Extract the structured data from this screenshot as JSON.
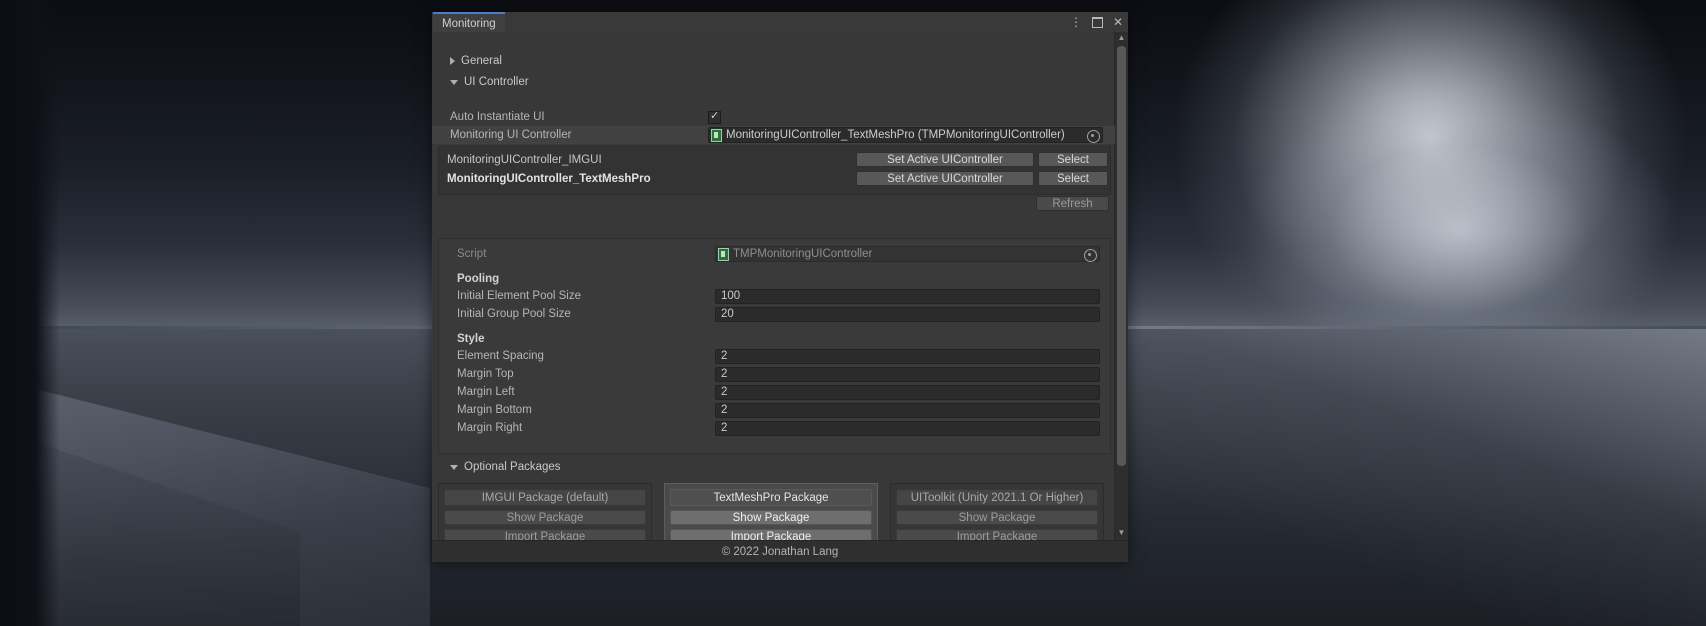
{
  "window": {
    "tab_label": "Monitoring",
    "menu_icon": "⋮",
    "maximize_icon": "maximize",
    "close_icon": "✕"
  },
  "foldouts": {
    "general": "General",
    "ui_controller": "UI Controller",
    "optional_packages": "Optional Packages"
  },
  "ui_controller": {
    "auto_instantiate_label": "Auto Instantiate UI",
    "auto_instantiate_checked": true,
    "controller_label": "Monitoring UI Controller",
    "controller_value": "MonitoringUIController_TextMeshPro (TMPMonitoringUIController)"
  },
  "controller_list": {
    "rows": [
      {
        "name": "MonitoringUIController_IMGUI",
        "active": false,
        "set_active_label": "Set Active UIController",
        "select_label": "Select"
      },
      {
        "name": "MonitoringUIController_TextMeshPro",
        "active": true,
        "set_active_label": "Set Active UIController",
        "select_label": "Select"
      }
    ],
    "refresh_label": "Refresh"
  },
  "inspector": {
    "script_label": "Script",
    "script_value": "TMPMonitoringUIController",
    "pooling_header": "Pooling",
    "style_header": "Style",
    "fields": [
      {
        "label": "Initial Element Pool Size",
        "value": "100"
      },
      {
        "label": "Initial Group Pool Size",
        "value": "20"
      },
      {
        "label": "Element Spacing",
        "value": "2"
      },
      {
        "label": "Margin Top",
        "value": "2"
      },
      {
        "label": "Margin Left",
        "value": "2"
      },
      {
        "label": "Margin Bottom",
        "value": "2"
      },
      {
        "label": "Margin Right",
        "value": "2"
      }
    ]
  },
  "packages": [
    {
      "title": "IMGUI Package (default)",
      "show_label": "Show Package",
      "import_label": "Import Package",
      "active": false
    },
    {
      "title": "TextMeshPro Package",
      "show_label": "Show Package",
      "import_label": "Import Package",
      "active": true
    },
    {
      "title": "UIToolkit (Unity 2021.1 Or Higher)",
      "show_label": "Show Package",
      "import_label": "Import Package",
      "active": false
    }
  ],
  "footer": {
    "copyright": "© 2022 Jonathan Lang"
  },
  "colors": {
    "tab_accent": "#4a7cc7",
    "window_bg": "#383838",
    "field_bg": "#2b2b2b"
  }
}
